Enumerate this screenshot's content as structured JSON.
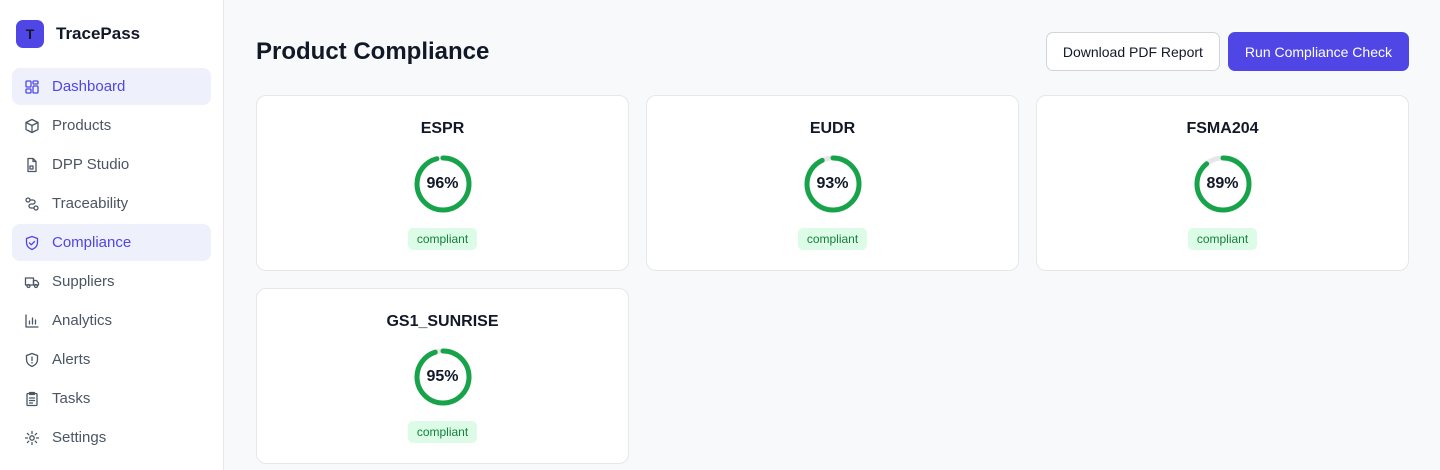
{
  "brand": {
    "logo_letter": "T",
    "name": "TracePass"
  },
  "nav": [
    {
      "label": "Dashboard",
      "icon": "dashboard-icon",
      "active": true
    },
    {
      "label": "Products",
      "icon": "box-icon",
      "active": false
    },
    {
      "label": "DPP Studio",
      "icon": "file-icon",
      "active": false
    },
    {
      "label": "Traceability",
      "icon": "route-icon",
      "active": false
    },
    {
      "label": "Compliance",
      "icon": "shield-check-icon",
      "active": true
    },
    {
      "label": "Suppliers",
      "icon": "truck-icon",
      "active": false
    },
    {
      "label": "Analytics",
      "icon": "bar-chart-icon",
      "active": false
    },
    {
      "label": "Alerts",
      "icon": "alert-shield-icon",
      "active": false
    },
    {
      "label": "Tasks",
      "icon": "clipboard-icon",
      "active": false
    },
    {
      "label": "Settings",
      "icon": "gear-icon",
      "active": false
    }
  ],
  "header": {
    "title": "Product Compliance",
    "download_label": "Download PDF Report",
    "run_label": "Run Compliance Check"
  },
  "colors": {
    "accent": "#4f46e5",
    "ring": "#16a34a",
    "ring_track": "#e5e7eb",
    "badge_bg": "#dcfce7",
    "badge_text": "#15803d"
  },
  "standards": [
    {
      "name": "ESPR",
      "score": 96,
      "score_label": "96%",
      "status": "compliant"
    },
    {
      "name": "EUDR",
      "score": 93,
      "score_label": "93%",
      "status": "compliant"
    },
    {
      "name": "FSMA204",
      "score": 89,
      "score_label": "89%",
      "status": "compliant"
    },
    {
      "name": "GS1_SUNRISE",
      "score": 95,
      "score_label": "95%",
      "status": "compliant"
    }
  ]
}
